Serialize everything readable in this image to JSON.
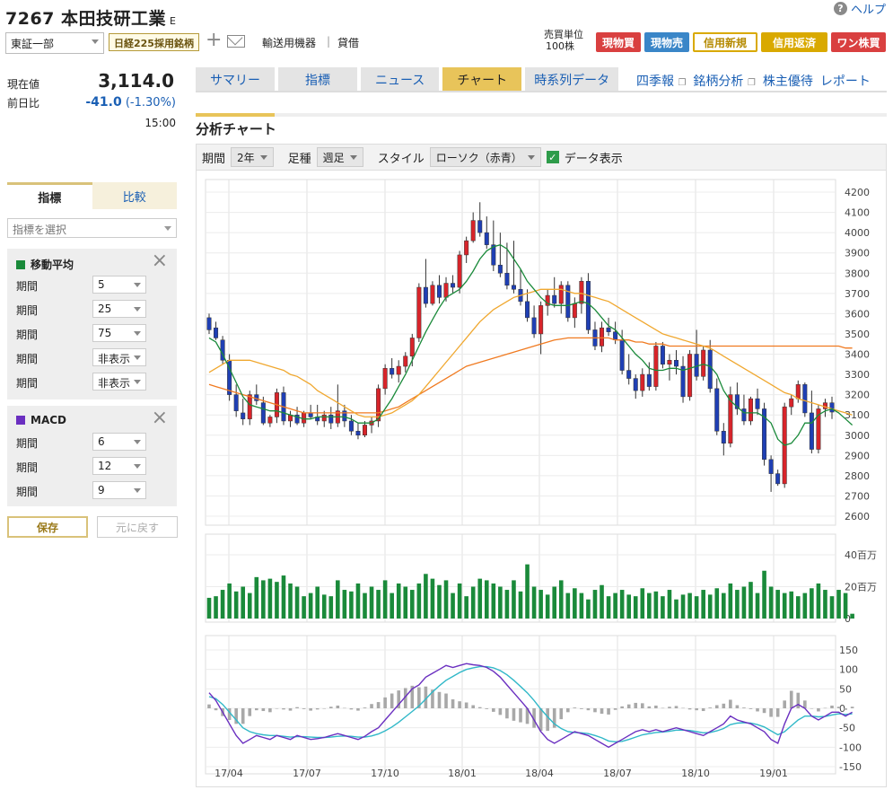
{
  "header": {
    "code": "7267",
    "name": "本田技研工業",
    "suffix": "E",
    "help": "ヘルプ",
    "market": "東証一部",
    "nikkei": "日経225採用銘柄",
    "sector": "輸送用機器",
    "separator": "|",
    "lending": "貸借",
    "unit_label": "売買単位",
    "unit_value": "100株"
  },
  "trade_buttons": [
    "現物買",
    "現物売",
    "信用新規",
    "信用返済",
    "ワン株買"
  ],
  "quote": {
    "price_label": "現在値",
    "price": "3,114.0",
    "change_label": "前日比",
    "change": "-41.0",
    "change_pct": "(-1.30%)",
    "time": "15:00"
  },
  "left_tabs": [
    "指標",
    "比較"
  ],
  "indicator_select": {
    "placeholder": "指標を選択"
  },
  "ma_panel": {
    "title": "移動平均",
    "color": "#1a8a3a",
    "row_label": "期間",
    "periods": [
      "5",
      "25",
      "75",
      "非表示",
      "非表示"
    ]
  },
  "macd_panel": {
    "title": "MACD",
    "color": "#6a2fc0",
    "row_label": "期間",
    "periods": [
      "6",
      "12",
      "9"
    ]
  },
  "buttons": {
    "save": "保存",
    "reset": "元に戻す"
  },
  "main_tabs": [
    "サマリー",
    "指標",
    "ニュース",
    "チャート",
    "時系列データ"
  ],
  "active_tab": "チャート",
  "top_links": [
    "四季報",
    "銘柄分析",
    "株主優待",
    "レポート"
  ],
  "chart_title": "分析チャート",
  "controls": {
    "period_label": "期間",
    "period": "2年",
    "bar_label": "足種",
    "bar": "週足",
    "style_label": "スタイル",
    "style": "ローソク（赤青）",
    "data_label": "データ表示"
  },
  "chart_data": {
    "type": "candlestick",
    "x_labels": [
      "17/04",
      "17/07",
      "17/10",
      "18/01",
      "18/04",
      "18/07",
      "18/10",
      "19/01"
    ],
    "price_axis": {
      "ticks": [
        4200,
        4100,
        4000,
        3900,
        3800,
        3700,
        3600,
        3500,
        3400,
        3300,
        3200,
        3100,
        3000,
        2900,
        2800,
        2700,
        2600
      ],
      "ylim": [
        2600,
        4200
      ]
    },
    "volume_axis": {
      "ticks": [
        "40百万",
        "20百万",
        "0"
      ],
      "ylim": [
        0,
        40
      ]
    },
    "macd_axis": {
      "ticks": [
        150,
        100,
        50,
        0,
        -50,
        -100,
        -150
      ],
      "ylim": [
        -150,
        150
      ]
    },
    "colors": {
      "up": "#d8242a",
      "down": "#1f3fb4",
      "ma5": "#1a8a3a",
      "ma25": "#f0a830",
      "ma75": "#f07a20",
      "volume": "#1a8a3a",
      "macd": "#6a2fc0",
      "signal": "#30b8c8",
      "hist": "#a8a8a8"
    },
    "candles": [
      [
        3580,
        3600,
        3500,
        3520
      ],
      [
        3530,
        3560,
        3470,
        3480
      ],
      [
        3470,
        3490,
        3350,
        3370
      ],
      [
        3370,
        3400,
        3170,
        3200
      ],
      [
        3200,
        3250,
        3090,
        3120
      ],
      [
        3110,
        3180,
        3050,
        3080
      ],
      [
        3080,
        3220,
        3050,
        3200
      ],
      [
        3200,
        3250,
        3150,
        3170
      ],
      [
        3160,
        3190,
        3050,
        3060
      ],
      [
        3060,
        3100,
        3040,
        3090
      ],
      [
        3090,
        3230,
        3060,
        3210
      ],
      [
        3210,
        3240,
        3050,
        3070
      ],
      [
        3070,
        3120,
        3040,
        3100
      ],
      [
        3100,
        3140,
        3050,
        3060
      ],
      [
        3060,
        3120,
        3040,
        3110
      ],
      [
        3110,
        3150,
        3080,
        3090
      ],
      [
        3090,
        3150,
        3050,
        3070
      ],
      [
        3070,
        3120,
        3040,
        3100
      ],
      [
        3100,
        3140,
        3030,
        3060
      ],
      [
        3060,
        3250,
        3040,
        3120
      ],
      [
        3120,
        3150,
        3040,
        3070
      ],
      [
        3070,
        3100,
        3000,
        3020
      ],
      [
        3020,
        3060,
        2980,
        3000
      ],
      [
        3000,
        3070,
        2990,
        3050
      ],
      [
        3050,
        3090,
        3010,
        3070
      ],
      [
        3070,
        3250,
        3040,
        3230
      ],
      [
        3230,
        3350,
        3200,
        3330
      ],
      [
        3330,
        3380,
        3280,
        3300
      ],
      [
        3300,
        3370,
        3260,
        3340
      ],
      [
        3340,
        3410,
        3310,
        3390
      ],
      [
        3390,
        3500,
        3340,
        3480
      ],
      [
        3480,
        3750,
        3460,
        3730
      ],
      [
        3730,
        3870,
        3630,
        3650
      ],
      [
        3650,
        3760,
        3640,
        3740
      ],
      [
        3740,
        3790,
        3650,
        3680
      ],
      [
        3680,
        3780,
        3660,
        3750
      ],
      [
        3750,
        3790,
        3700,
        3730
      ],
      [
        3730,
        3910,
        3700,
        3890
      ],
      [
        3890,
        3980,
        3850,
        3960
      ],
      [
        3960,
        4100,
        3950,
        4060
      ],
      [
        4060,
        4150,
        3980,
        4000
      ],
      [
        4000,
        4080,
        3920,
        3940
      ],
      [
        3940,
        4060,
        3810,
        3840
      ],
      [
        3840,
        4000,
        3780,
        3800
      ],
      [
        3800,
        3950,
        3720,
        3740
      ],
      [
        3740,
        3960,
        3700,
        3720
      ],
      [
        3720,
        3820,
        3640,
        3660
      ],
      [
        3660,
        3720,
        3560,
        3580
      ],
      [
        3580,
        3640,
        3480,
        3500
      ],
      [
        3500,
        3660,
        3400,
        3640
      ],
      [
        3640,
        3720,
        3590,
        3690
      ],
      [
        3690,
        3780,
        3630,
        3650
      ],
      [
        3650,
        3760,
        3600,
        3740
      ],
      [
        3740,
        3760,
        3560,
        3580
      ],
      [
        3580,
        3680,
        3530,
        3650
      ],
      [
        3650,
        3780,
        3600,
        3760
      ],
      [
        3760,
        3800,
        3500,
        3520
      ],
      [
        3520,
        3560,
        3420,
        3440
      ],
      [
        3440,
        3560,
        3410,
        3530
      ],
      [
        3530,
        3580,
        3490,
        3510
      ],
      [
        3510,
        3560,
        3450,
        3470
      ],
      [
        3470,
        3520,
        3300,
        3320
      ],
      [
        3320,
        3400,
        3250,
        3280
      ],
      [
        3280,
        3300,
        3180,
        3220
      ],
      [
        3220,
        3330,
        3190,
        3300
      ],
      [
        3300,
        3360,
        3220,
        3240
      ],
      [
        3240,
        3460,
        3220,
        3440
      ],
      [
        3440,
        3460,
        3330,
        3350
      ],
      [
        3350,
        3400,
        3270,
        3370
      ],
      [
        3370,
        3420,
        3300,
        3340
      ],
      [
        3340,
        3390,
        3160,
        3190
      ],
      [
        3190,
        3420,
        3170,
        3400
      ],
      [
        3400,
        3520,
        3270,
        3290
      ],
      [
        3290,
        3440,
        3270,
        3420
      ],
      [
        3420,
        3470,
        3210,
        3230
      ],
      [
        3230,
        3280,
        3000,
        3020
      ],
      [
        3020,
        3060,
        2900,
        2960
      ],
      [
        2960,
        3240,
        2940,
        3200
      ],
      [
        3200,
        3260,
        3100,
        3130
      ],
      [
        3130,
        3200,
        3050,
        3070
      ],
      [
        3070,
        3190,
        3050,
        3180
      ],
      [
        3180,
        3230,
        3100,
        3130
      ],
      [
        3130,
        3160,
        2850,
        2880
      ],
      [
        2880,
        2900,
        2720,
        2810
      ],
      [
        2810,
        2830,
        2750,
        2760
      ],
      [
        2760,
        3160,
        2740,
        3140
      ],
      [
        3140,
        3200,
        3100,
        3180
      ],
      [
        3180,
        3270,
        3160,
        3250
      ],
      [
        3250,
        3260,
        3090,
        3110
      ],
      [
        3110,
        3220,
        2910,
        2930
      ],
      [
        2930,
        3150,
        2910,
        3130
      ],
      [
        3130,
        3180,
        3090,
        3160
      ],
      [
        3160,
        3190,
        3080,
        3114
      ]
    ],
    "volume": [
      13,
      14,
      18,
      22,
      17,
      20,
      16,
      26,
      24,
      25,
      23,
      27,
      22,
      20,
      14,
      16,
      20,
      15,
      14,
      24,
      18,
      17,
      22,
      16,
      20,
      18,
      24,
      16,
      22,
      20,
      18,
      22,
      28,
      25,
      21,
      24,
      16,
      22,
      14,
      20,
      25,
      24,
      22,
      20,
      18,
      24,
      17,
      34,
      20,
      18,
      15,
      20,
      24,
      16,
      19,
      16,
      12,
      18,
      21,
      14,
      16,
      18,
      15,
      14,
      19,
      16,
      17,
      14,
      18,
      12,
      15,
      16,
      14,
      18,
      15,
      19,
      16,
      22,
      18,
      20,
      23,
      16,
      30,
      20,
      18,
      16,
      17,
      14,
      16,
      19,
      22,
      18,
      14,
      18,
      16,
      3
    ],
    "ma5": [
      3480,
      3460,
      3400,
      3330,
      3260,
      3190,
      3150,
      3140,
      3130,
      3120,
      3120,
      3110,
      3100,
      3090,
      3080,
      3080,
      3090,
      3090,
      3090,
      3090,
      3090,
      3080,
      3060,
      3060,
      3060,
      3080,
      3130,
      3180,
      3240,
      3300,
      3370,
      3440,
      3510,
      3570,
      3630,
      3680,
      3700,
      3720,
      3760,
      3810,
      3870,
      3910,
      3930,
      3940,
      3920,
      3870,
      3820,
      3760,
      3720,
      3680,
      3650,
      3640,
      3640,
      3640,
      3650,
      3660,
      3650,
      3620,
      3580,
      3540,
      3520,
      3480,
      3440,
      3400,
      3370,
      3330,
      3320,
      3320,
      3330,
      3330,
      3320,
      3330,
      3340,
      3350,
      3340,
      3300,
      3220,
      3170,
      3140,
      3110,
      3110,
      3110,
      3090,
      3060,
      2980,
      2950,
      2960,
      3000,
      3060,
      3060,
      3100,
      3120,
      3130,
      3110,
      3080,
      3050
    ],
    "ma25": [
      3310,
      3330,
      3350,
      3370,
      3370,
      3370,
      3370,
      3360,
      3350,
      3340,
      3330,
      3320,
      3300,
      3290,
      3270,
      3250,
      3220,
      3200,
      3180,
      3160,
      3140,
      3120,
      3100,
      3090,
      3090,
      3090,
      3100,
      3110,
      3130,
      3150,
      3170,
      3200,
      3240,
      3280,
      3320,
      3360,
      3400,
      3440,
      3480,
      3520,
      3560,
      3590,
      3620,
      3640,
      3660,
      3680,
      3690,
      3700,
      3710,
      3720,
      3720,
      3720,
      3720,
      3710,
      3700,
      3700,
      3690,
      3680,
      3670,
      3660,
      3640,
      3620,
      3600,
      3580,
      3560,
      3540,
      3520,
      3500,
      3490,
      3480,
      3470,
      3460,
      3450,
      3440,
      3430,
      3410,
      3390,
      3370,
      3350,
      3330,
      3310,
      3290,
      3270,
      3250,
      3230,
      3210,
      3200,
      3180,
      3170,
      3160,
      3150,
      3140,
      3130,
      3120,
      3110,
      3100
    ],
    "ma75": [
      3250,
      3240,
      3230,
      3220,
      3210,
      3200,
      3190,
      3180,
      3170,
      3160,
      3150,
      3140,
      3130,
      3120,
      3110,
      3110,
      3110,
      3110,
      3110,
      3110,
      3110,
      3110,
      3110,
      3110,
      3110,
      3110,
      3120,
      3130,
      3140,
      3160,
      3180,
      3200,
      3220,
      3240,
      3260,
      3280,
      3300,
      3320,
      3340,
      3350,
      3360,
      3370,
      3380,
      3390,
      3400,
      3410,
      3420,
      3430,
      3440,
      3450,
      3460,
      3470,
      3475,
      3480,
      3480,
      3480,
      3480,
      3480,
      3480,
      3480,
      3470,
      3470,
      3470,
      3460,
      3460,
      3450,
      3450,
      3450,
      3440,
      3440,
      3440,
      3440,
      3440,
      3440,
      3440,
      3440,
      3440,
      3440,
      3440,
      3440,
      3440,
      3440,
      3440,
      3440,
      3440,
      3440,
      3440,
      3440,
      3440,
      3440,
      3440,
      3440,
      3440,
      3440,
      3430,
      3430
    ],
    "macd": [
      40,
      20,
      -10,
      -40,
      -70,
      -90,
      -80,
      -70,
      -75,
      -80,
      -70,
      -75,
      -80,
      -70,
      -75,
      -80,
      -78,
      -75,
      -70,
      -65,
      -70,
      -75,
      -80,
      -72,
      -60,
      -50,
      -30,
      -10,
      10,
      30,
      50,
      60,
      80,
      90,
      100,
      110,
      105,
      110,
      115,
      112,
      110,
      105,
      95,
      80,
      60,
      40,
      20,
      0,
      -30,
      -60,
      -80,
      -90,
      -80,
      -70,
      -60,
      -65,
      -70,
      -80,
      -90,
      -100,
      -90,
      -80,
      -70,
      -60,
      -55,
      -60,
      -55,
      -60,
      -55,
      -50,
      -55,
      -60,
      -65,
      -70,
      -60,
      -50,
      -40,
      -20,
      -30,
      -35,
      -40,
      -50,
      -60,
      -80,
      -90,
      -40,
      0,
      10,
      0,
      -20,
      -30,
      -20,
      -10,
      -10,
      -20,
      -10
    ],
    "signal": [
      30,
      25,
      10,
      -10,
      -30,
      -50,
      -60,
      -65,
      -68,
      -70,
      -70,
      -72,
      -74,
      -73,
      -73,
      -74,
      -75,
      -75,
      -74,
      -72,
      -71,
      -72,
      -74,
      -74,
      -71,
      -66,
      -58,
      -48,
      -36,
      -22,
      -8,
      6,
      24,
      42,
      58,
      72,
      82,
      92,
      100,
      104,
      107,
      107,
      104,
      97,
      86,
      72,
      56,
      40,
      20,
      -2,
      -22,
      -40,
      -52,
      -60,
      -62,
      -63,
      -65,
      -70,
      -76,
      -84,
      -86,
      -85,
      -80,
      -74,
      -68,
      -65,
      -62,
      -61,
      -59,
      -56,
      -56,
      -57,
      -60,
      -63,
      -62,
      -58,
      -52,
      -42,
      -38,
      -37,
      -38,
      -42,
      -48,
      -58,
      -68,
      -60,
      -45,
      -30,
      -20,
      -20,
      -22,
      -21,
      -17,
      -14,
      -16,
      -14
    ],
    "hist": [
      10,
      -5,
      -20,
      -30,
      -40,
      -40,
      -20,
      -5,
      -7,
      -10,
      0,
      -3,
      -6,
      3,
      -2,
      -6,
      -3,
      0,
      4,
      7,
      1,
      -3,
      -6,
      2,
      11,
      16,
      28,
      38,
      46,
      52,
      58,
      54,
      56,
      48,
      42,
      38,
      23,
      18,
      15,
      8,
      3,
      -2,
      -9,
      -17,
      -26,
      -32,
      -36,
      -40,
      -50,
      -58,
      -58,
      -50,
      -28,
      -10,
      2,
      -2,
      -5,
      -10,
      -14,
      -16,
      -4,
      5,
      10,
      14,
      13,
      5,
      7,
      1,
      4,
      6,
      1,
      -3,
      -5,
      -7,
      2,
      8,
      12,
      22,
      8,
      2,
      -2,
      -8,
      -12,
      -22,
      -22,
      20,
      45,
      40,
      20,
      0,
      -8,
      1,
      7,
      4,
      -4,
      4
    ]
  }
}
